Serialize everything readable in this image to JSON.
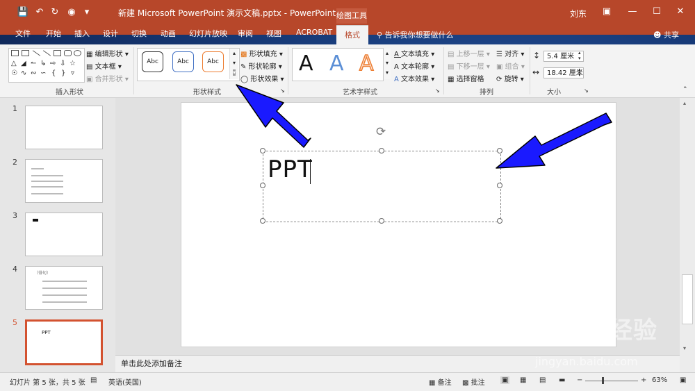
{
  "titlebar": {
    "document_title": "新建 Microsoft PowerPoint 演示文稿.pptx  -  PowerPoint",
    "contextual_tools": "绘图工具",
    "user": "刘东"
  },
  "tabs": [
    "文件",
    "开始",
    "插入",
    "设计",
    "切换",
    "动画",
    "幻灯片放映",
    "审阅",
    "视图",
    "ACROBAT"
  ],
  "active_tab": "格式",
  "tell_me": "告诉我你想要做什么",
  "share": "共享",
  "ribbon": {
    "insert_shapes": {
      "label": "插入形状",
      "edit_shape": "编辑形状",
      "text_box": "文本框",
      "merge_shapes": "合并形状"
    },
    "shape_styles": {
      "label": "形状样式",
      "style_sample": "Abc",
      "fill": "形状填充",
      "outline": "形状轮廓",
      "effects": "形状效果"
    },
    "wordart": {
      "label": "艺术字样式",
      "letter": "A",
      "text_fill": "文本填充",
      "text_outline": "文本轮廓",
      "text_effects": "文本效果"
    },
    "arrange": {
      "label": "排列",
      "bring_forward": "上移一层",
      "send_backward": "下移一层",
      "selection_pane": "选择窗格",
      "align": "对齐",
      "group": "组合",
      "rotate": "旋转"
    },
    "size": {
      "label": "大小",
      "height": "5.4 厘米",
      "width": "18.42 厘米"
    }
  },
  "slides": [
    {
      "number": "1"
    },
    {
      "number": "2"
    },
    {
      "number": "3"
    },
    {
      "number": "4",
      "text": "（俳句）"
    },
    {
      "number": "5",
      "text": "PPT"
    }
  ],
  "slide": {
    "textbox_text": "PPT"
  },
  "notes_placeholder": "单击此处添加备注",
  "status": {
    "slide_info": "幻灯片 第 5 张，共 5 张",
    "language": "英语(美国)",
    "notes": "备注",
    "comments": "批注",
    "zoom": "63%"
  },
  "watermark": {
    "main": "Baidu经验",
    "sub": "jingyan.baidu.com"
  },
  "colors": {
    "accent": "#b7472a",
    "arrow": "#1a1aff",
    "selected_thumb": "#d35230"
  }
}
